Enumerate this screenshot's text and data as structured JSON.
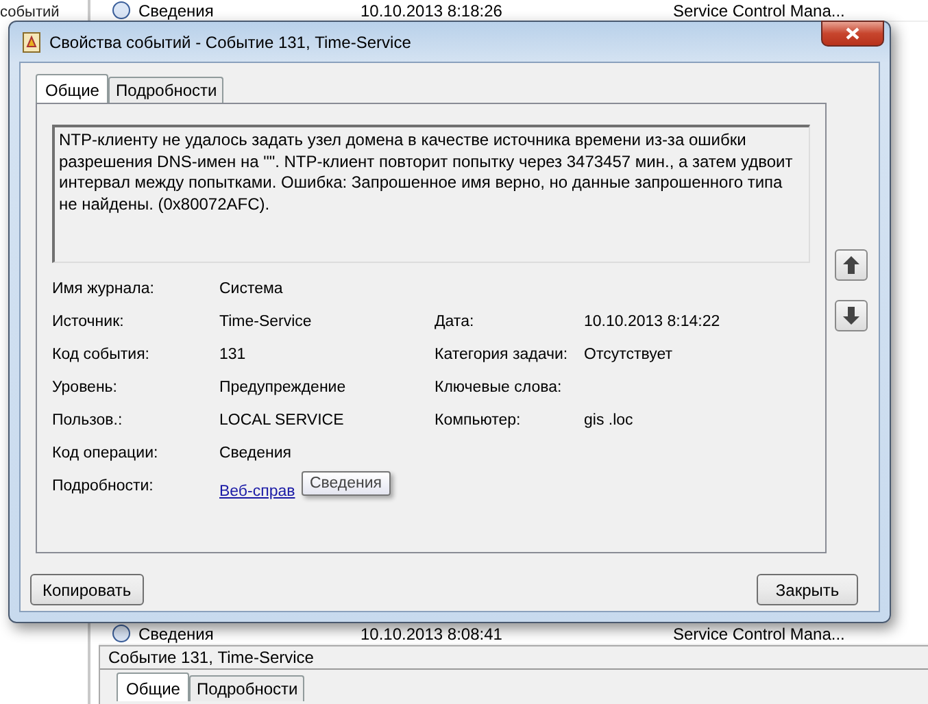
{
  "background": {
    "sidebar_text": "событий",
    "rows": [
      {
        "level": "Сведения",
        "date": "10.10.2013 8:18:26",
        "source": "Service Control Mana..."
      },
      {
        "level": "Сведения",
        "date": "10.10.2013 8:08:41",
        "source": "Service Control Mana..."
      }
    ],
    "preview_title": "Событие 131, Time-Service",
    "preview_tabs": [
      {
        "label": "Общие",
        "selected": true
      },
      {
        "label": "Подробности",
        "selected": false
      }
    ]
  },
  "dialog": {
    "title": "Свойства событий - Событие 131, Time-Service",
    "tabs": [
      {
        "label": "Общие",
        "selected": true
      },
      {
        "label": "Подробности",
        "selected": false
      }
    ],
    "message": "NTP-клиенту не удалось задать узел домена в качестве источника времени из-за ошибки разрешения DNS-имен на \"\". NTP-клиент повторит попытку через 3473457 мин., а затем удвоит интервал между попытками. Ошибка: Запрошенное имя верно, но данные запрошенного типа не найдены. (0x80072AFC).",
    "fields_left": [
      {
        "label": "Имя журнала:",
        "value": "Система"
      },
      {
        "label": "Источник:",
        "value": "Time-Service"
      },
      {
        "label": "Код события:",
        "value": "131"
      },
      {
        "label": "Уровень:",
        "value": "Предупреждение"
      },
      {
        "label": "Пользов.:",
        "value": "LOCAL SERVICE"
      },
      {
        "label": "Код операции:",
        "value": "Сведения"
      },
      {
        "label": "Подробности:",
        "value": "Веб-справ",
        "kind": "link"
      }
    ],
    "fields_right": [
      {
        "label": "Дата:",
        "value": "10.10.2013 8:14:22"
      },
      {
        "label": "Категория задачи:",
        "value": "Отсутствует"
      },
      {
        "label": "Ключевые слова:"
      },
      {
        "label": "Компьютер:",
        "value": "gis .loc"
      }
    ],
    "tooltip": "Сведения",
    "buttons": {
      "copy": "Копировать",
      "close": "Закрыть"
    }
  }
}
